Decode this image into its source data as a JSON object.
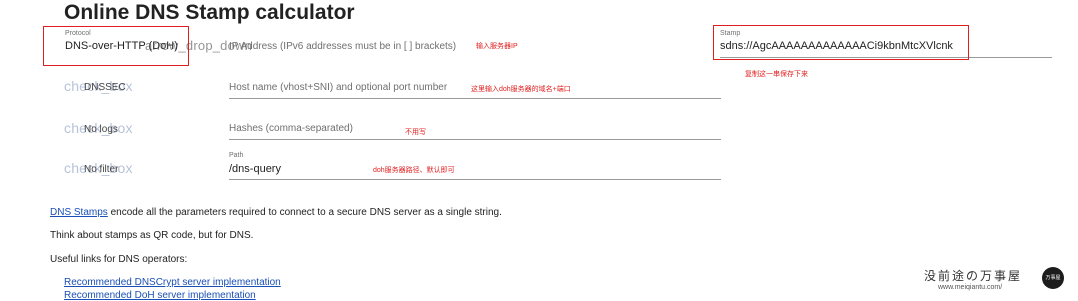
{
  "page": {
    "title": "Online DNS Stamp calculator"
  },
  "form": {
    "protocol": {
      "label": "Protocol",
      "value": "DNS-over-HTTP (DoH)",
      "dropdown_ligature": "arrow_drop_down"
    },
    "ip_address": {
      "placeholder": "IP Address (IPv6 addresses must be in [ ] brackets)"
    },
    "stamp": {
      "label": "Stamp",
      "value": "sdns://AgcAAAAAAAAAAAAACi9kbnMtcXVlcnk"
    },
    "checkboxes": [
      {
        "ligature": "check_box",
        "label": "DNSSEC"
      },
      {
        "ligature": "check_box",
        "label": "No logs"
      },
      {
        "ligature": "check_box",
        "label": "No filter"
      }
    ],
    "hostname": {
      "placeholder": "Host name (vhost+SNI) and optional port number"
    },
    "hashes": {
      "placeholder": "Hashes (comma-separated)"
    },
    "path": {
      "label": "Path",
      "value": "/dns-query"
    }
  },
  "annotations": {
    "ip": "输入服务器IP",
    "stamp": "复制这一串保存下来",
    "hostname": "这里输入doh服务器的域名+端口",
    "hashes": "不用写",
    "path": "doh服务器路径、默认即可"
  },
  "description": {
    "link": "DNS Stamps",
    "text1_rest": " encode all the parameters required to connect to a secure DNS server as a single string.",
    "text2": "Think about stamps as QR code, but for DNS.",
    "text3": "Useful links for DNS operators:",
    "links": [
      "Recommended DNSCrypt server implementation",
      "Recommended DoH server implementation"
    ]
  },
  "watermark": {
    "text": "没前途の万事屋",
    "url": "www.meiqiantu.com/",
    "seal": "万事屋"
  },
  "colors": {
    "annotation": "#e02020",
    "link": "#1a4fb5",
    "ligature": "#b7c3d8"
  }
}
